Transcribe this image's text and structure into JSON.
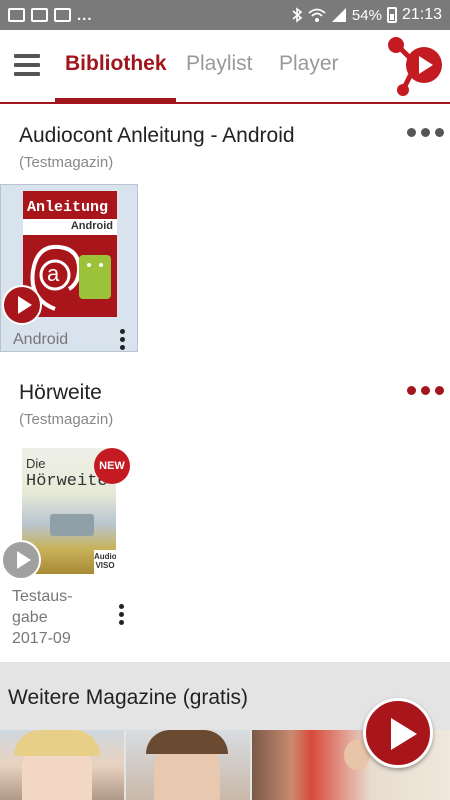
{
  "statusbar": {
    "dots": "...",
    "battery": "54%",
    "time": "21:13",
    "icons": [
      "image-icon",
      "mail-icon",
      "mail-icon",
      "bluetooth-icon",
      "wifi-icon",
      "signal-icon",
      "battery-icon"
    ]
  },
  "appbar": {
    "tabs": [
      {
        "label": "Bibliothek",
        "active": true
      },
      {
        "label": "Playlist",
        "active": false
      },
      {
        "label": "Player",
        "active": false
      }
    ],
    "accent": "#a0161c"
  },
  "sections": [
    {
      "title": "Audiocont Anleitung - Android",
      "subtitle": "(Testmagazin)",
      "more_color": "#555555",
      "item": {
        "cover_title": "Anleitung",
        "cover_sub": "Android",
        "cover_letter": "a",
        "label": "Android"
      }
    },
    {
      "title": "Hörweite",
      "subtitle": "(Testmagazin)",
      "more_color": "#a0161c",
      "item": {
        "cover_title": "Die",
        "cover_title2": "Hörweite",
        "badge": "NEW",
        "brand": "Audio",
        "brand2": "VISO",
        "label_lines": [
          "Testaus-",
          "gabe",
          "2017-09"
        ]
      }
    }
  ],
  "more": {
    "title": "Weitere Magazine (gratis)"
  }
}
